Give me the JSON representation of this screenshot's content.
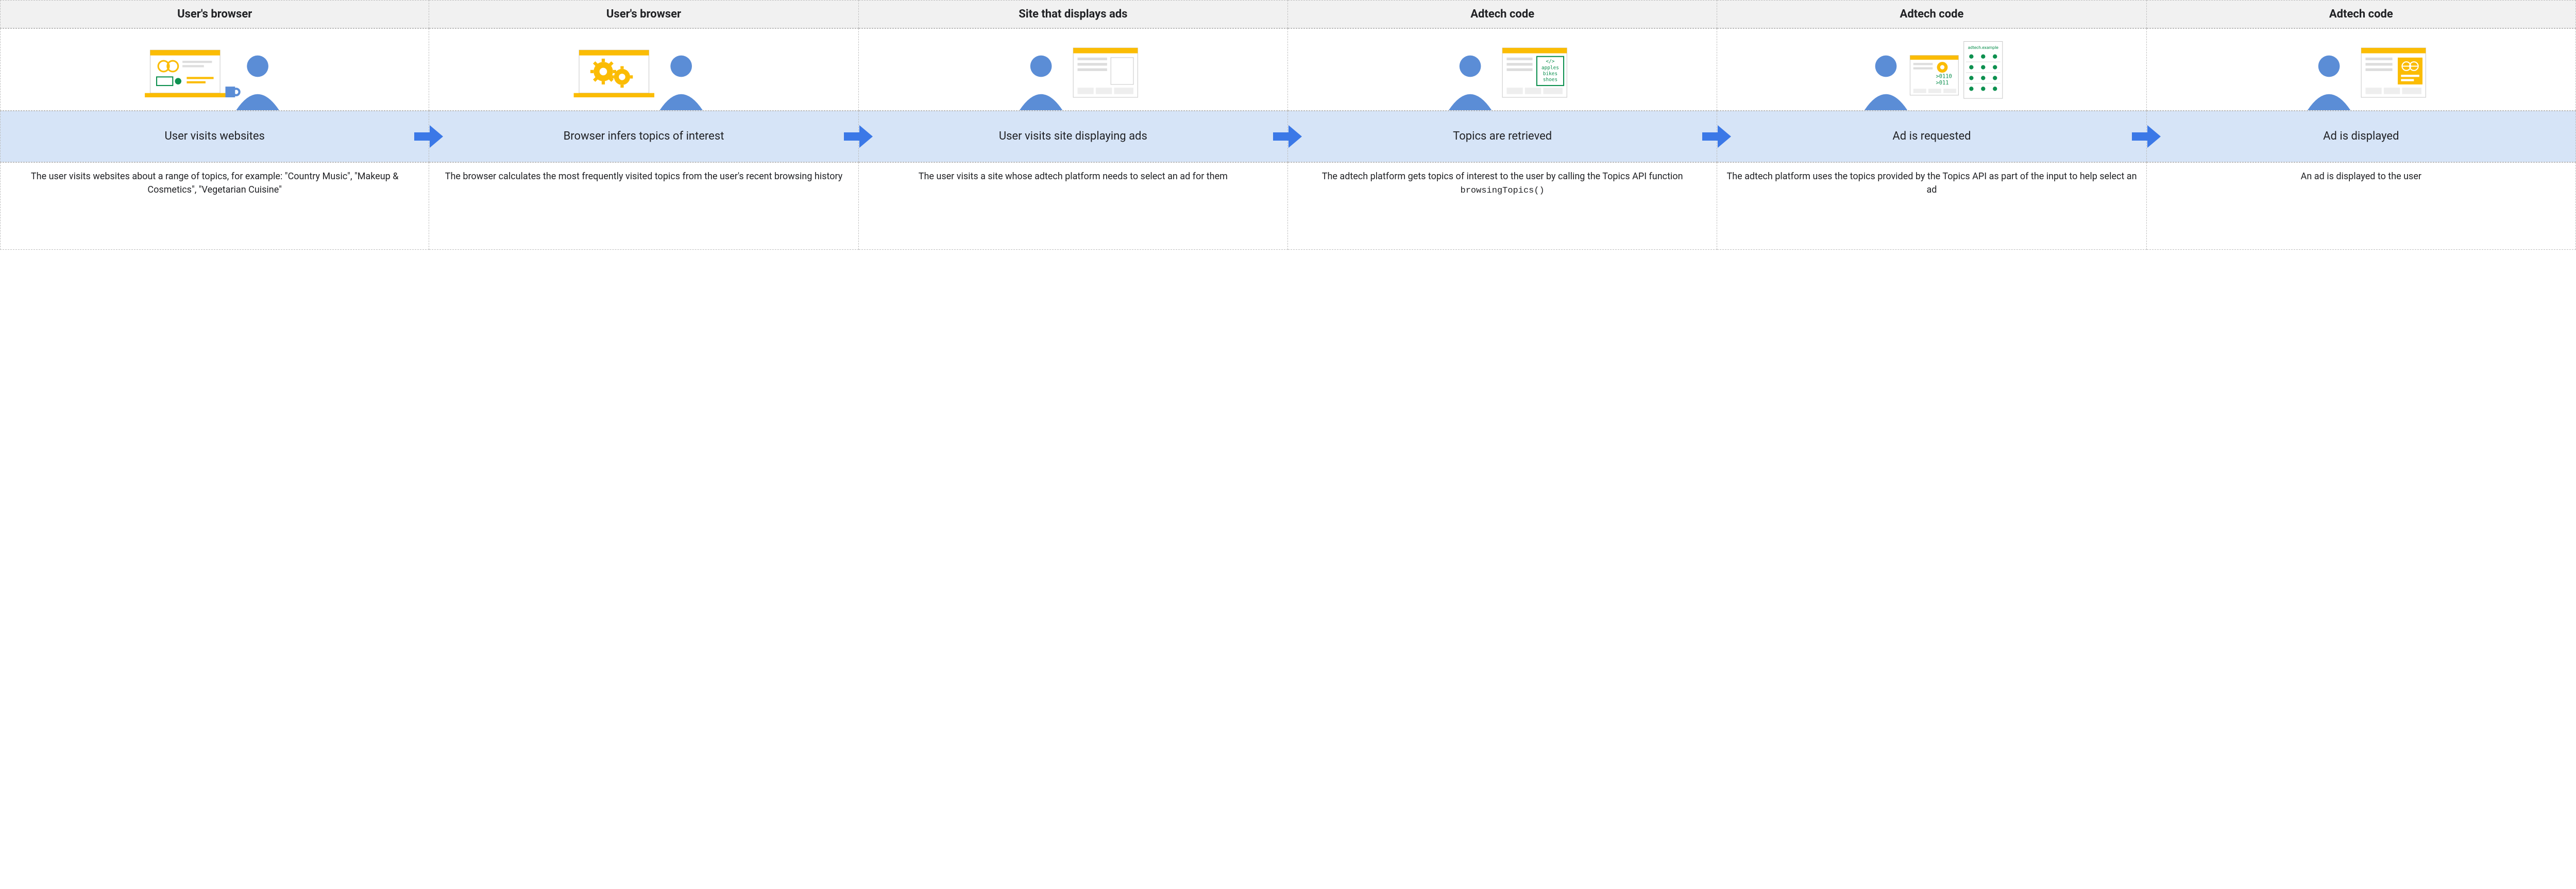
{
  "steps": [
    {
      "header": "User's browser",
      "step_label": "User visits websites",
      "description": "The user visits websites about a range of topics, for example: \"Country Music\", \"Makeup & Cosmetics\", \"Vegetarian Cuisine\"",
      "code": ""
    },
    {
      "header": "User's browser",
      "step_label": "Browser infers topics of interest",
      "description": "The browser calculates the most frequently visited topics from the user's recent browsing history",
      "code": ""
    },
    {
      "header": "Site that displays ads",
      "step_label": "User visits site displaying ads",
      "description": "The user visits a site whose adtech platform needs to select an ad for them",
      "code": ""
    },
    {
      "header": "Adtech code",
      "step_label": "Topics are retrieved",
      "description": "The adtech platform gets topics of interest to the user by calling the Topics API function ",
      "code": "browsingTopics()"
    },
    {
      "header": "Adtech code",
      "step_label": "Ad is requested",
      "description": "The adtech platform uses the topics provided by the Topics API as part of the input to help select an ad",
      "code": ""
    },
    {
      "header": "Adtech code",
      "step_label": "Ad is displayed",
      "description": "An ad is displayed to the user",
      "code": ""
    }
  ],
  "illus": {
    "server_label": "adtech.example",
    "topics": [
      "apples",
      "bikes",
      "shoes"
    ]
  },
  "colors": {
    "yellow": "#fbbc04",
    "blue": "#5b8dd6",
    "blue_dark": "#3b78e7",
    "band": "#d6e4f7",
    "green": "#0d904f"
  }
}
